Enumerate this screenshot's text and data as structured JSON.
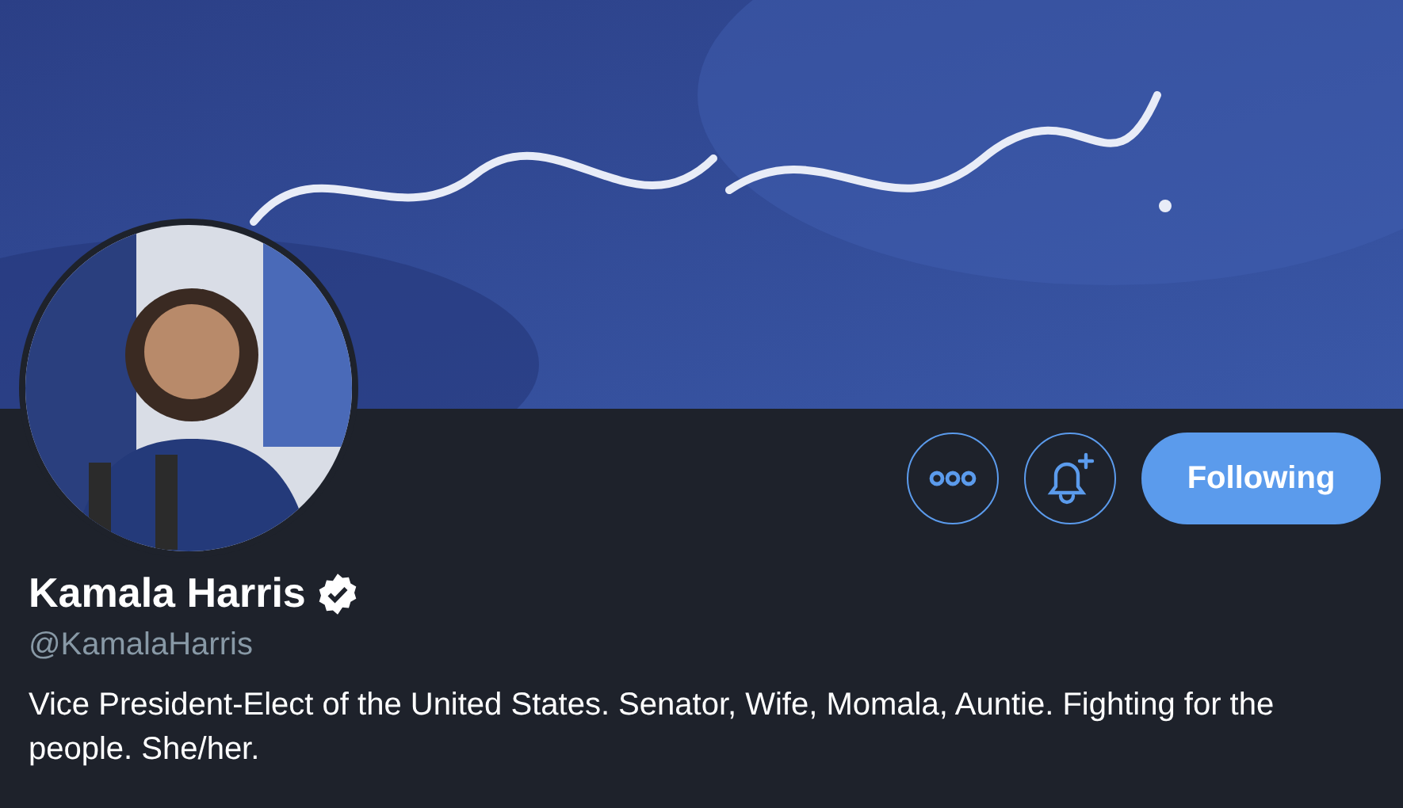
{
  "actions": [
    {
      "kind": "more"
    },
    {
      "kind": "notify"
    }
  ],
  "follow_button": {
    "label": "Following",
    "following": true
  },
  "profile": {
    "name": "Kamala Harris",
    "verified": true,
    "handle": "@KamalaHarris",
    "bio": "Vice President-Elect of the United States. Senator, Wife, Momala, Auntie. Fighting for the people. She/her."
  }
}
